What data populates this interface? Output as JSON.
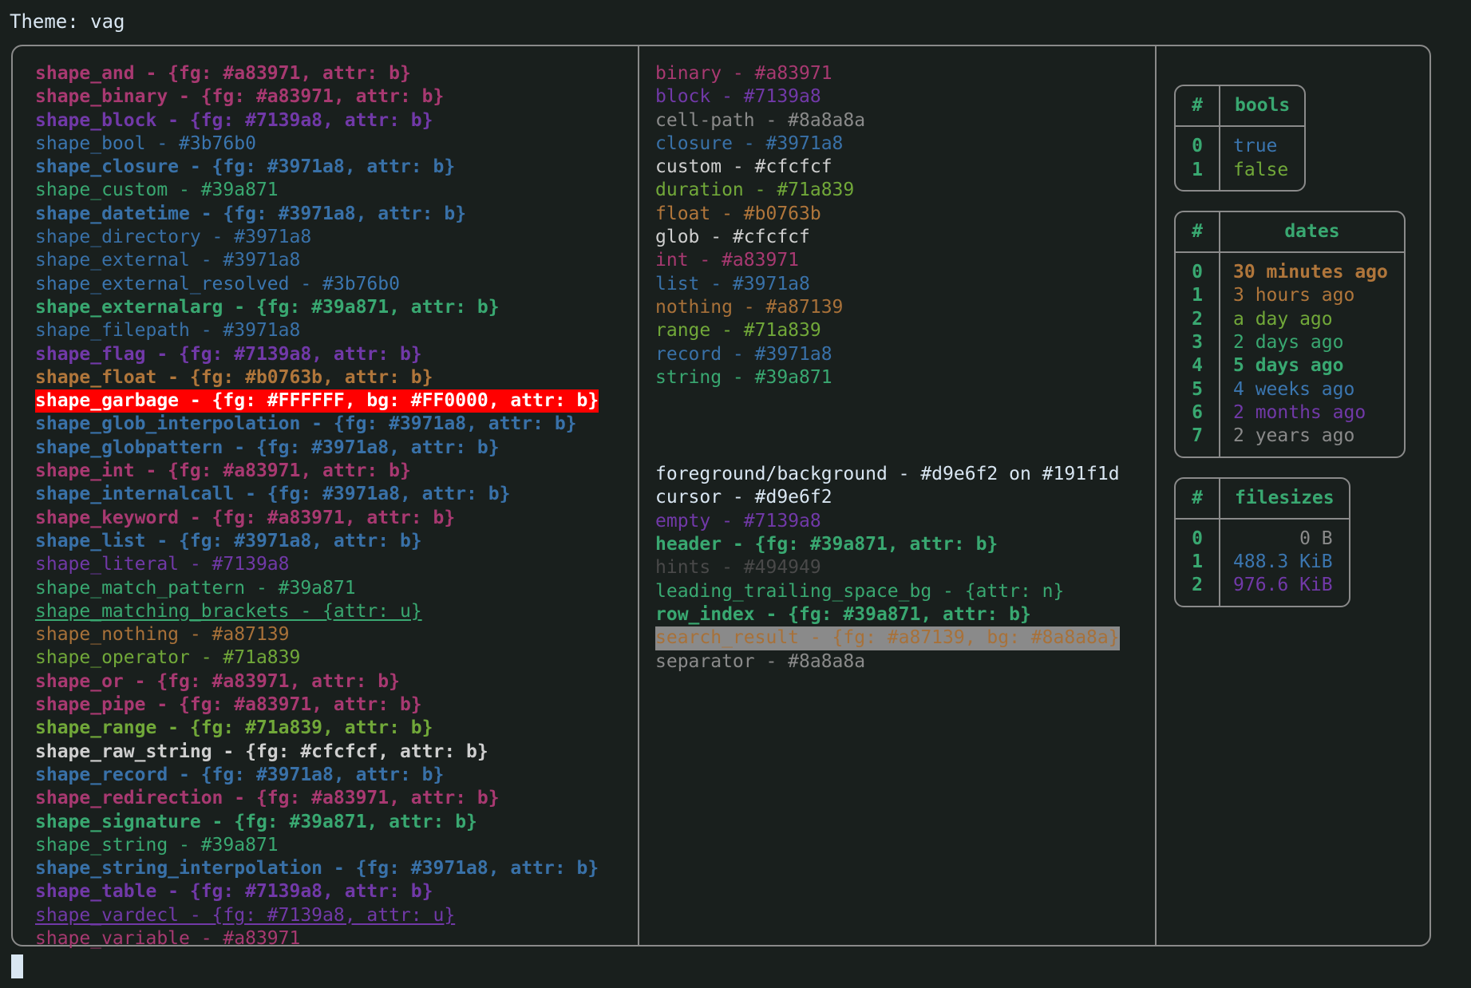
{
  "header": {
    "theme_label": "Theme: vag"
  },
  "colors": {
    "background": "#191f1d",
    "foreground": "#d9e6f2",
    "border": "#8a8a8a",
    "red": "#a83971",
    "purple": "#7139a8",
    "blue": "#3971a8",
    "light_blue": "#3b76b0",
    "green": "#39a871",
    "yellow_green": "#71a839",
    "orange": "#a87139",
    "brown": "#b0763b",
    "white": "#cfcfcf",
    "gray": "#8a8a8a",
    "dim": "#494949",
    "garbage_fg": "#FFFFFF",
    "garbage_bg": "#FF0000"
  },
  "shapes": [
    {
      "text": "shape_and - {fg: #a83971, attr: b}",
      "color": "#a83971",
      "bold": true
    },
    {
      "text": "shape_binary - {fg: #a83971, attr: b}",
      "color": "#a83971",
      "bold": true
    },
    {
      "text": "shape_block - {fg: #7139a8, attr: b}",
      "color": "#7139a8",
      "bold": true
    },
    {
      "text": "shape_bool - #3b76b0",
      "color": "#3b76b0",
      "bold": false
    },
    {
      "text": "shape_closure - {fg: #3971a8, attr: b}",
      "color": "#3971a8",
      "bold": true
    },
    {
      "text": "shape_custom - #39a871",
      "color": "#39a871",
      "bold": false
    },
    {
      "text": "shape_datetime - {fg: #3971a8, attr: b}",
      "color": "#3971a8",
      "bold": true
    },
    {
      "text": "shape_directory - #3971a8",
      "color": "#3971a8",
      "bold": false
    },
    {
      "text": "shape_external - #3971a8",
      "color": "#3971a8",
      "bold": false
    },
    {
      "text": "shape_external_resolved - #3b76b0",
      "color": "#3b76b0",
      "bold": false
    },
    {
      "text": "shape_externalarg - {fg: #39a871, attr: b}",
      "color": "#39a871",
      "bold": true
    },
    {
      "text": "shape_filepath - #3971a8",
      "color": "#3971a8",
      "bold": false
    },
    {
      "text": "shape_flag - {fg: #7139a8, attr: b}",
      "color": "#7139a8",
      "bold": true
    },
    {
      "text": "shape_float - {fg: #b0763b, attr: b}",
      "color": "#b0763b",
      "bold": true
    },
    {
      "text": "shape_garbage - {fg: #FFFFFF, bg: #FF0000, attr: b}",
      "color": "#FFFFFF",
      "bg": "#FF0000",
      "bold": true
    },
    {
      "text": "shape_glob_interpolation - {fg: #3971a8, attr: b}",
      "color": "#3971a8",
      "bold": true
    },
    {
      "text": "shape_globpattern - {fg: #3971a8, attr: b}",
      "color": "#3971a8",
      "bold": true
    },
    {
      "text": "shape_int - {fg: #a83971, attr: b}",
      "color": "#a83971",
      "bold": true
    },
    {
      "text": "shape_internalcall - {fg: #3971a8, attr: b}",
      "color": "#3971a8",
      "bold": true
    },
    {
      "text": "shape_keyword - {fg: #a83971, attr: b}",
      "color": "#a83971",
      "bold": true
    },
    {
      "text": "shape_list - {fg: #3971a8, attr: b}",
      "color": "#3971a8",
      "bold": true
    },
    {
      "text": "shape_literal - #7139a8",
      "color": "#7139a8",
      "bold": false
    },
    {
      "text": "shape_match_pattern - #39a871",
      "color": "#39a871",
      "bold": false
    },
    {
      "text": "shape_matching_brackets - {attr: u}",
      "color": "#39a871",
      "bold": false,
      "underline": true
    },
    {
      "text": "shape_nothing - #a87139",
      "color": "#a87139",
      "bold": false
    },
    {
      "text": "shape_operator - #71a839",
      "color": "#71a839",
      "bold": false
    },
    {
      "text": "shape_or - {fg: #a83971, attr: b}",
      "color": "#a83971",
      "bold": true
    },
    {
      "text": "shape_pipe - {fg: #a83971, attr: b}",
      "color": "#a83971",
      "bold": true
    },
    {
      "text": "shape_range - {fg: #71a839, attr: b}",
      "color": "#71a839",
      "bold": true
    },
    {
      "text": "shape_raw_string - {fg: #cfcfcf, attr: b}",
      "color": "#cfcfcf",
      "bold": true
    },
    {
      "text": "shape_record - {fg: #3971a8, attr: b}",
      "color": "#3971a8",
      "bold": true
    },
    {
      "text": "shape_redirection - {fg: #a83971, attr: b}",
      "color": "#a83971",
      "bold": true
    },
    {
      "text": "shape_signature - {fg: #39a871, attr: b}",
      "color": "#39a871",
      "bold": true
    },
    {
      "text": "shape_string - #39a871",
      "color": "#39a871",
      "bold": false
    },
    {
      "text": "shape_string_interpolation - {fg: #3971a8, attr: b}",
      "color": "#3971a8",
      "bold": true
    },
    {
      "text": "shape_table - {fg: #7139a8, attr: b}",
      "color": "#7139a8",
      "bold": true
    },
    {
      "text": "shape_vardecl - {fg: #7139a8, attr: u}",
      "color": "#7139a8",
      "bold": false,
      "underline": true
    },
    {
      "text": "shape_variable - #a83971",
      "color": "#a83971",
      "bold": false
    }
  ],
  "types": [
    {
      "text": "binary - #a83971",
      "color": "#a83971",
      "bold": false
    },
    {
      "text": "block - #7139a8",
      "color": "#7139a8",
      "bold": false
    },
    {
      "text": "cell-path - #8a8a8a",
      "color": "#8a8a8a",
      "bold": false
    },
    {
      "text": "closure - #3971a8",
      "color": "#3971a8",
      "bold": false
    },
    {
      "text": "custom - #cfcfcf",
      "color": "#cfcfcf",
      "bold": false
    },
    {
      "text": "duration - #71a839",
      "color": "#71a839",
      "bold": false
    },
    {
      "text": "float - #b0763b",
      "color": "#b0763b",
      "bold": false
    },
    {
      "text": "glob - #cfcfcf",
      "color": "#cfcfcf",
      "bold": false
    },
    {
      "text": "int - #a83971",
      "color": "#a83971",
      "bold": false
    },
    {
      "text": "list - #3971a8",
      "color": "#3971a8",
      "bold": false
    },
    {
      "text": "nothing - #a87139",
      "color": "#a87139",
      "bold": false
    },
    {
      "text": "range - #71a839",
      "color": "#71a839",
      "bold": false
    },
    {
      "text": "record - #3971a8",
      "color": "#3971a8",
      "bold": false
    },
    {
      "text": "string - #39a871",
      "color": "#39a871",
      "bold": false
    }
  ],
  "ui_elements": [
    {
      "text": "foreground/background - #d9e6f2 on #191f1d",
      "color": "#d9e6f2",
      "bold": false
    },
    {
      "text": "cursor - #d9e6f2",
      "color": "#d9e6f2",
      "bold": false
    },
    {
      "text": "empty - #7139a8",
      "color": "#7139a8",
      "bold": false
    },
    {
      "text": "header - {fg: #39a871, attr: b}",
      "color": "#39a871",
      "bold": true
    },
    {
      "text": "hints - #494949",
      "color": "#494949",
      "bold": false
    },
    {
      "text": "leading_trailing_space_bg - {attr: n}",
      "color": "#39a871",
      "bold": false
    },
    {
      "text": "row_index - {fg: #39a871, attr: b}",
      "color": "#39a871",
      "bold": true
    },
    {
      "text": "search_result - {fg: #a87139, bg: #8a8a8a}",
      "color": "#a87139",
      "bg": "#8a8a8a",
      "bold": false
    },
    {
      "text": "separator - #8a8a8a",
      "color": "#8a8a8a",
      "bold": false
    }
  ],
  "tables": [
    {
      "name": "bools",
      "index_header": "#",
      "value_header": "bools",
      "align": "left",
      "rows": [
        {
          "index": "0",
          "value": "true",
          "color": "#3b76b0",
          "bold": false
        },
        {
          "index": "1",
          "value": "false",
          "color": "#71a839",
          "bold": false
        }
      ]
    },
    {
      "name": "dates",
      "index_header": "#",
      "value_header": "dates",
      "align": "left",
      "rows": [
        {
          "index": "0",
          "value": "30 minutes ago",
          "color": "#b0763b",
          "bold": true
        },
        {
          "index": "1",
          "value": "3 hours ago",
          "color": "#b0763b",
          "bold": false
        },
        {
          "index": "2",
          "value": "a day ago",
          "color": "#71a839",
          "bold": false
        },
        {
          "index": "3",
          "value": "2 days ago",
          "color": "#39a871",
          "bold": false
        },
        {
          "index": "4",
          "value": "5 days ago",
          "color": "#39a871",
          "bold": true
        },
        {
          "index": "5",
          "value": "4 weeks ago",
          "color": "#3b76b0",
          "bold": false
        },
        {
          "index": "6",
          "value": "2 months ago",
          "color": "#7139a8",
          "bold": false
        },
        {
          "index": "7",
          "value": "2 years ago",
          "color": "#8a8a8a",
          "bold": false
        }
      ]
    },
    {
      "name": "filesizes",
      "index_header": "#",
      "value_header": "filesizes",
      "align": "right",
      "rows": [
        {
          "index": "0",
          "value": "0 B",
          "color": "#8a8a8a",
          "bold": false
        },
        {
          "index": "1",
          "value": "488.3 KiB",
          "color": "#3b76b0",
          "bold": false
        },
        {
          "index": "2",
          "value": "976.6 KiB",
          "color": "#7139a8",
          "bold": false
        }
      ]
    }
  ],
  "prompt": {
    "cursor": "block"
  }
}
